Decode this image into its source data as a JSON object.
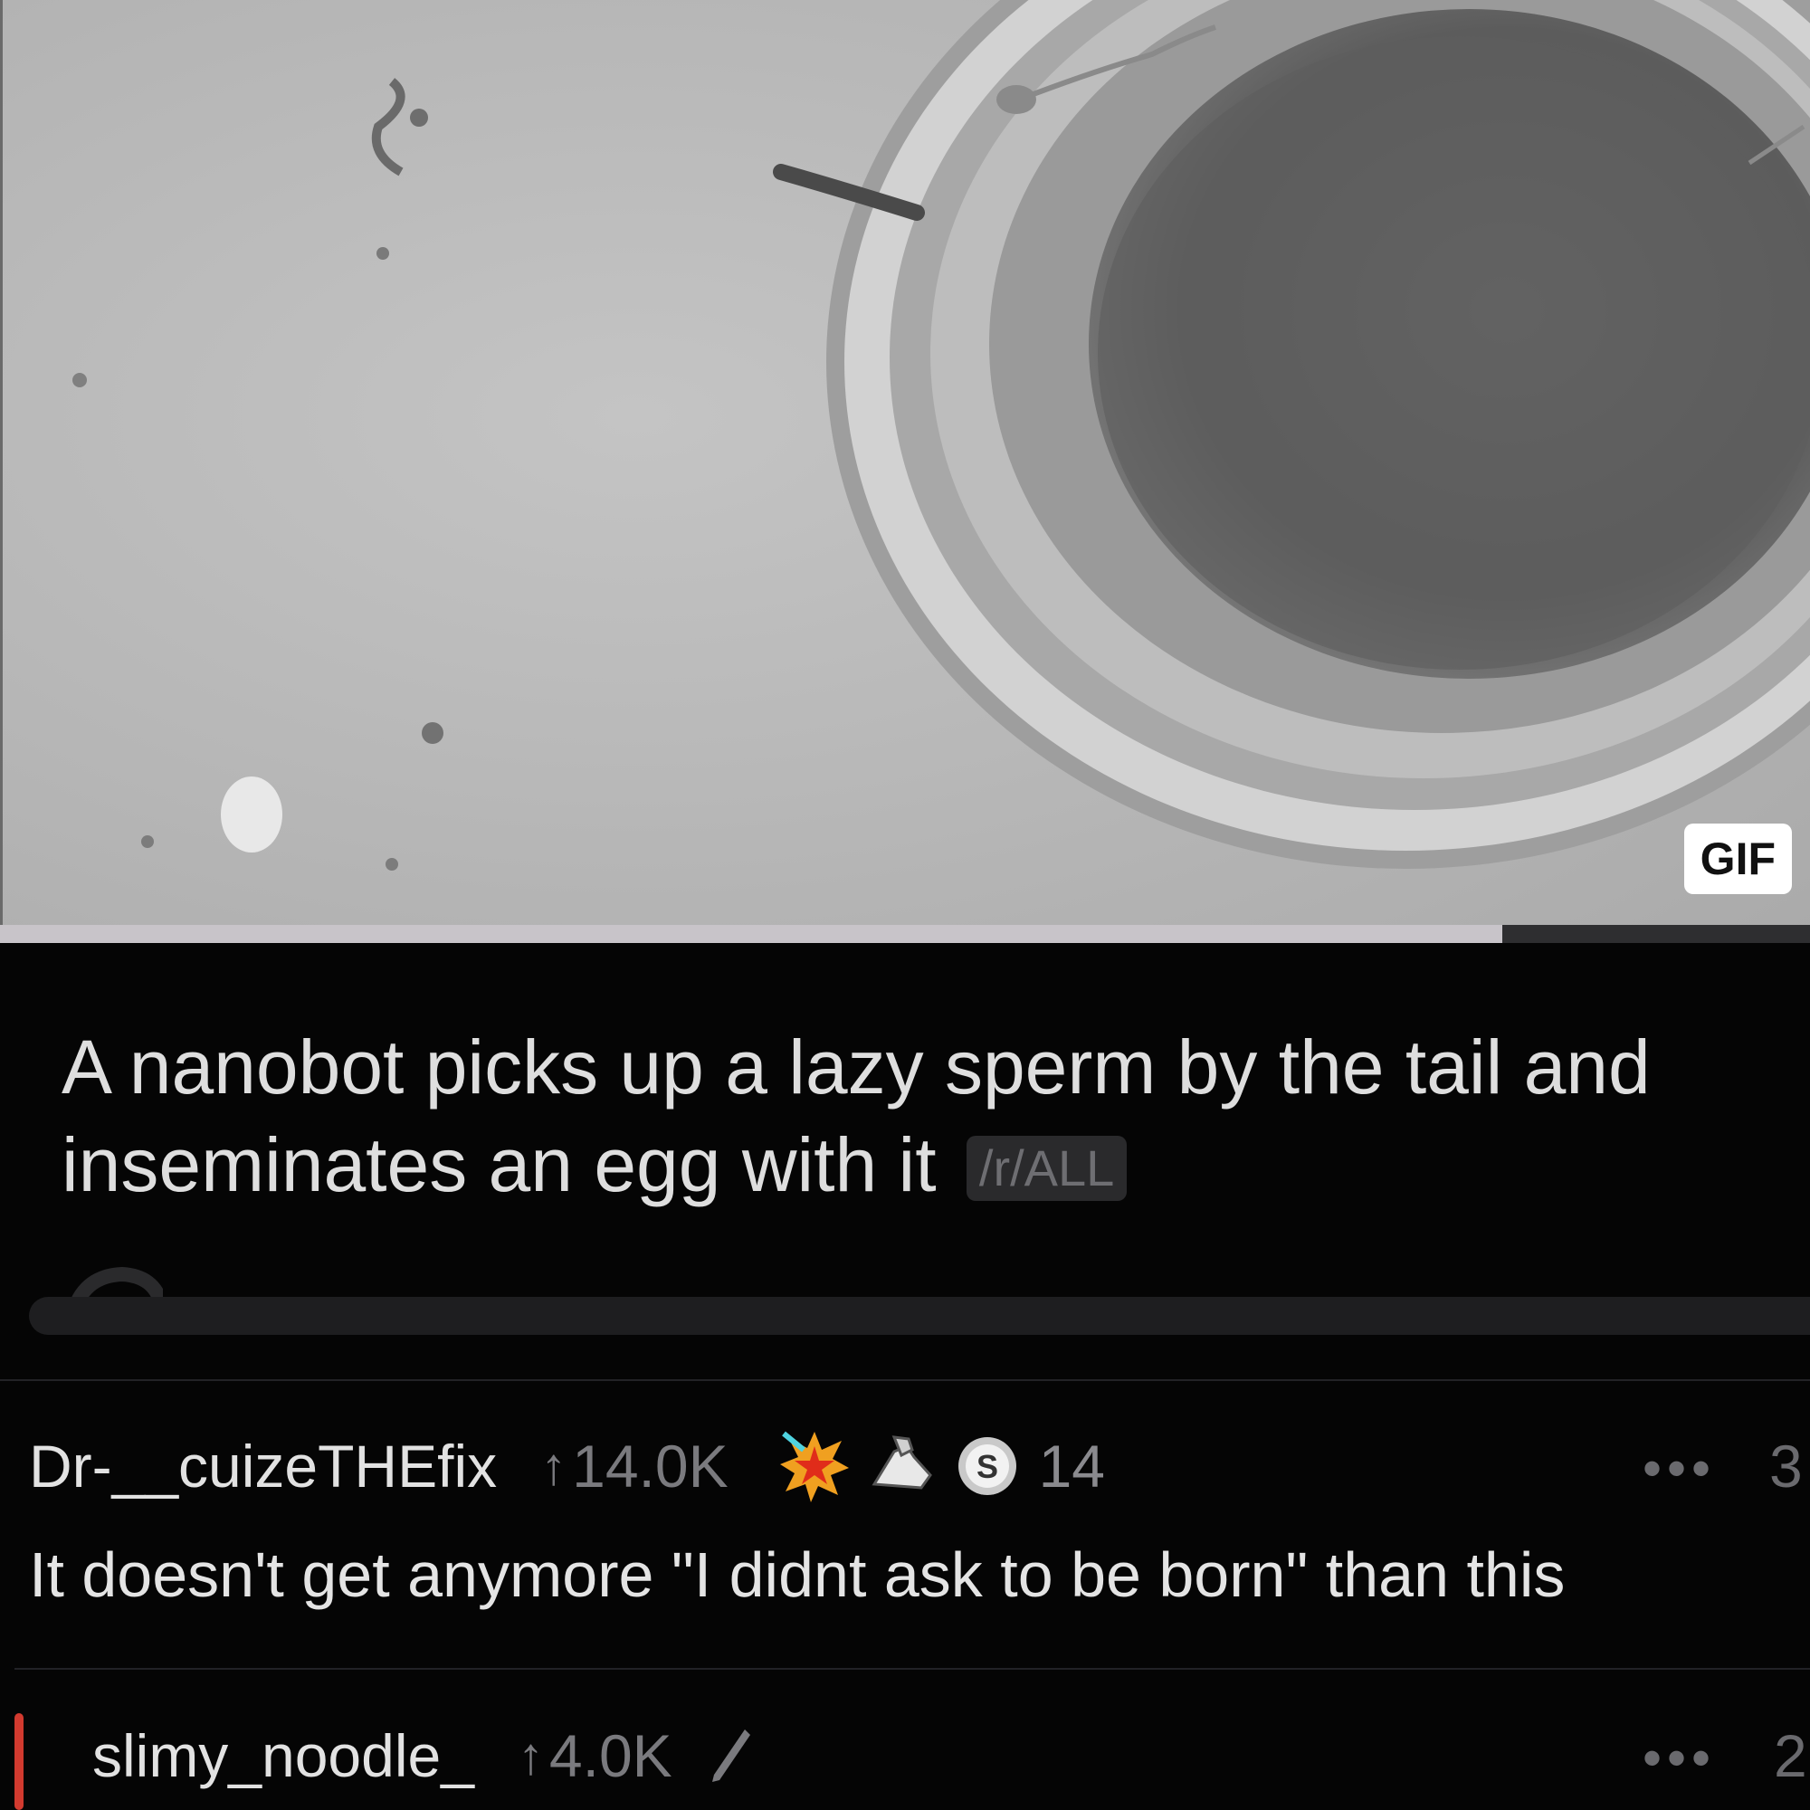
{
  "post": {
    "media_badge": "GIF",
    "playback_progress": 0.83,
    "title": "A nanobot picks up a lazy sperm by the tail and inseminates an egg with it",
    "subreddit_tag": "/r/ALL"
  },
  "comments": [
    {
      "username": "Dr-__cuizeTHEfix",
      "score": "14.0K",
      "awards": [
        "explosion-star-award-icon",
        "arm-wrestle-award-icon",
        "silver-coin-award-icon"
      ],
      "award_count": "14",
      "more": "•••",
      "child_count": "3",
      "body": "It doesn't get anymore \"I didnt ask to be born\" than this"
    },
    {
      "username": "slimy_noodle_",
      "score": "4.0K",
      "edited": true,
      "more": "•••",
      "child_count": "2",
      "thread_color": "#d23a2f"
    }
  ]
}
